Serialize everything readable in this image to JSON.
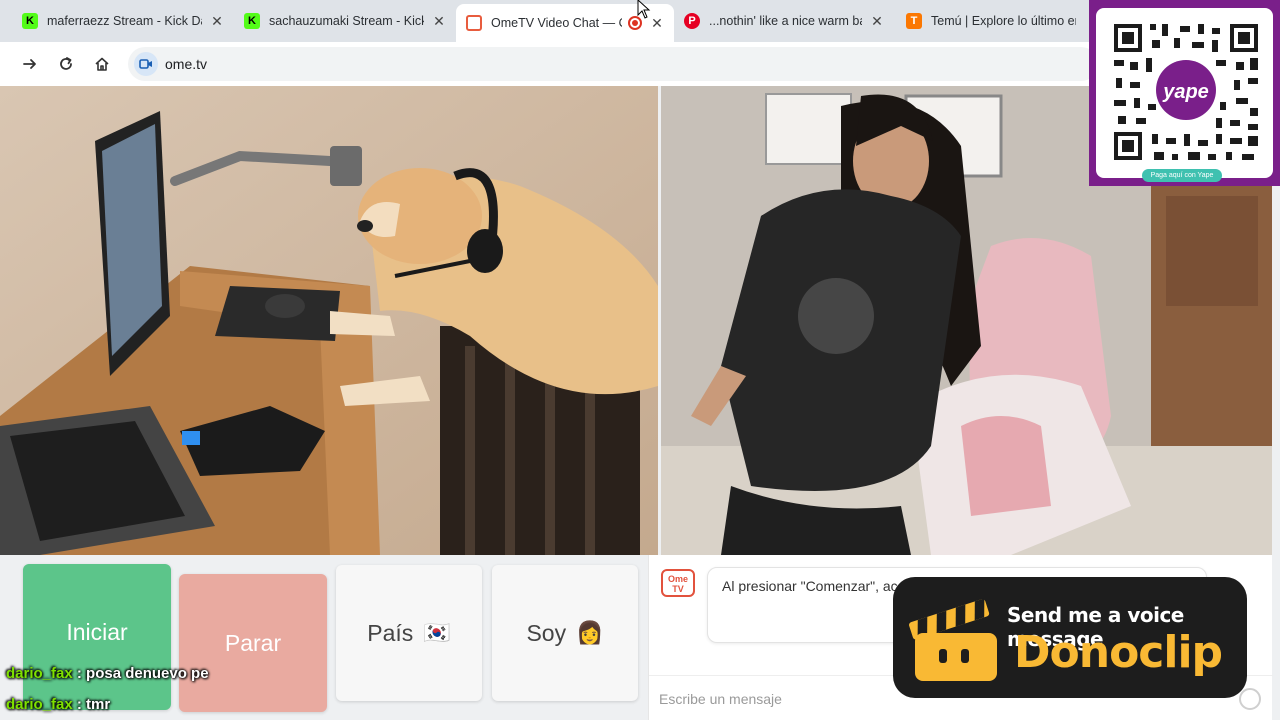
{
  "browser": {
    "tabs": [
      {
        "title": "maferraezz Stream - Kick Da",
        "icon": "kick-icon",
        "active": false
      },
      {
        "title": "sachauzumaki Stream - Kick",
        "icon": "kick-icon",
        "active": false
      },
      {
        "title": "OmeTV Video Chat — O",
        "icon": "ometv-icon",
        "active": true,
        "recording": true
      },
      {
        "title": "...nothin' like a nice warm ba",
        "icon": "pinterest-icon",
        "active": false
      },
      {
        "title": "Temú | Explore lo último en",
        "icon": "temu-icon",
        "active": false
      }
    ],
    "close_glyph": "✕",
    "url": "ome.tv"
  },
  "app": {
    "buttons": {
      "start": "Iniciar",
      "stop": "Parar",
      "country": "País",
      "country_flag": "🇰🇷",
      "gender": "Soy",
      "gender_emoji": "👩"
    },
    "chat": {
      "logo_text": "Ome TV",
      "system_message": "Al presionar \"Comenzar\", ac las reglas serán expulsad marco de la cámara.",
      "input_placeholder": "Escribe un mensaje"
    }
  },
  "overlays": {
    "qr": {
      "brand": "yape",
      "caption": "Paga aquí con Yape"
    },
    "donoclip": {
      "tagline": "Send me a voice message",
      "brand": "Donoclip"
    },
    "stream_chat": [
      {
        "user": "dario_fax",
        "message": " : posa denuevo pe"
      },
      {
        "user": "dario_fax",
        "message": " : tmr"
      }
    ]
  },
  "colors": {
    "start_button": "#5cc58a",
    "stop_button": "#e9aaa0",
    "ometv_red": "#e2523d",
    "yape_purple": "#7a1f8a",
    "donoclip_yellow": "#f9b934"
  }
}
